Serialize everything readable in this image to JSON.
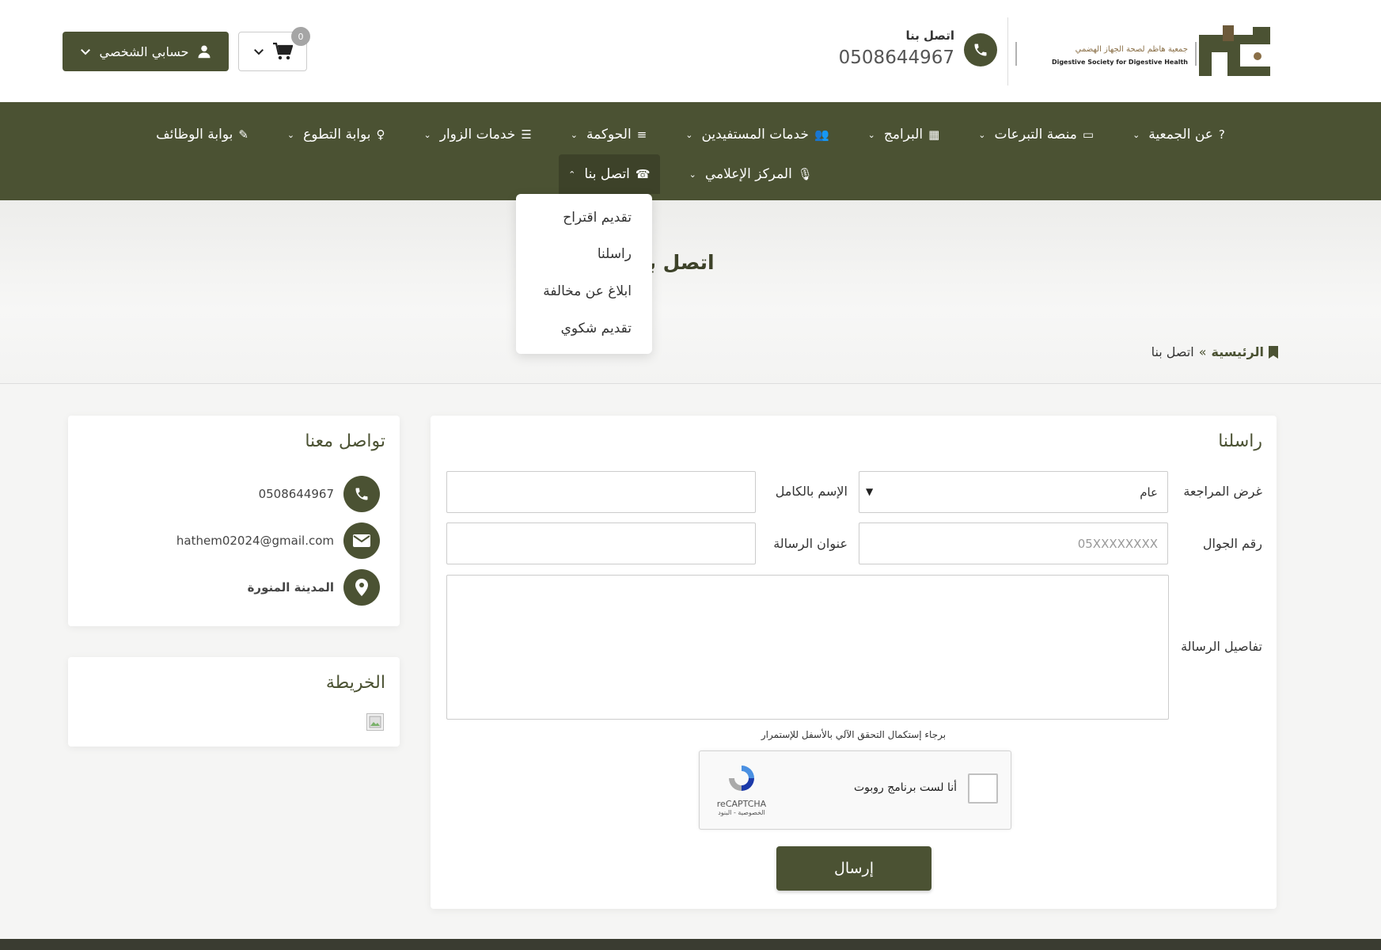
{
  "header": {
    "logo_text_ar": "جمعية هاظم لصحة الجهاز الهضمي",
    "logo_text_en": "Digestive Society for Digestive Health",
    "contact_label": "اتصل بنا",
    "contact_phone": "0508644967",
    "account_label": "حسابي الشخصي",
    "cart_count": "0"
  },
  "nav": {
    "row1": [
      {
        "label": "عن الجمعية",
        "icon": "?"
      },
      {
        "label": "منصة التبرعات",
        "icon": "▭"
      },
      {
        "label": "البرامج",
        "icon": "▦"
      },
      {
        "label": "خدمات المستفيدين",
        "icon": "👥"
      },
      {
        "label": "الحوكمة",
        "icon": "≡"
      },
      {
        "label": "خدمات الزوار",
        "icon": "☰"
      },
      {
        "label": "بوابة التطوع",
        "icon": "♀"
      },
      {
        "label": "بوابة الوظائف",
        "icon": "✎"
      }
    ],
    "row2": [
      {
        "label": "المركز الإعلامي",
        "icon": "🎙"
      },
      {
        "label": "اتصل بنا",
        "icon": "☎"
      }
    ]
  },
  "dropdown": {
    "items": [
      "تقديم اقتراح",
      "راسلنا",
      "ابلاغ عن مخالفة",
      "تقديم شكوي"
    ]
  },
  "hero": {
    "title": "اتصل بنا",
    "breadcrumb_home": "الرئيسية",
    "breadcrumb_sep": "»",
    "breadcrumb_current": "اتصل بنا"
  },
  "form": {
    "title": "راسلنا",
    "purpose_label": "غرض المراجعة",
    "purpose_value": "عام",
    "fullname_label": "الإسم بالكامل",
    "mobile_label": "رقم الجوال",
    "mobile_placeholder": "05XXXXXXXX",
    "subject_label": "عنوان الرسالة",
    "details_label": "تفاصيل الرسالة",
    "captcha_note": "برجاء إستكمال التحقق الآلي بالأسفل للإستمرار",
    "captcha_text": "أنا لست برنامج روبوت",
    "captcha_brand": "reCAPTCHA",
    "captcha_links": "الخصوصية - البنود",
    "submit_label": "إرسال"
  },
  "contact_card": {
    "title": "تواصل معنا",
    "phone": "0508644967",
    "email": "hathem02024@gmail.com",
    "location": "المدينة المنورة"
  },
  "map_card": {
    "title": "الخريطة"
  },
  "colors": {
    "brand": "#4b5233",
    "brand_dark": "#3d4229",
    "footer": "#3a3c31"
  }
}
